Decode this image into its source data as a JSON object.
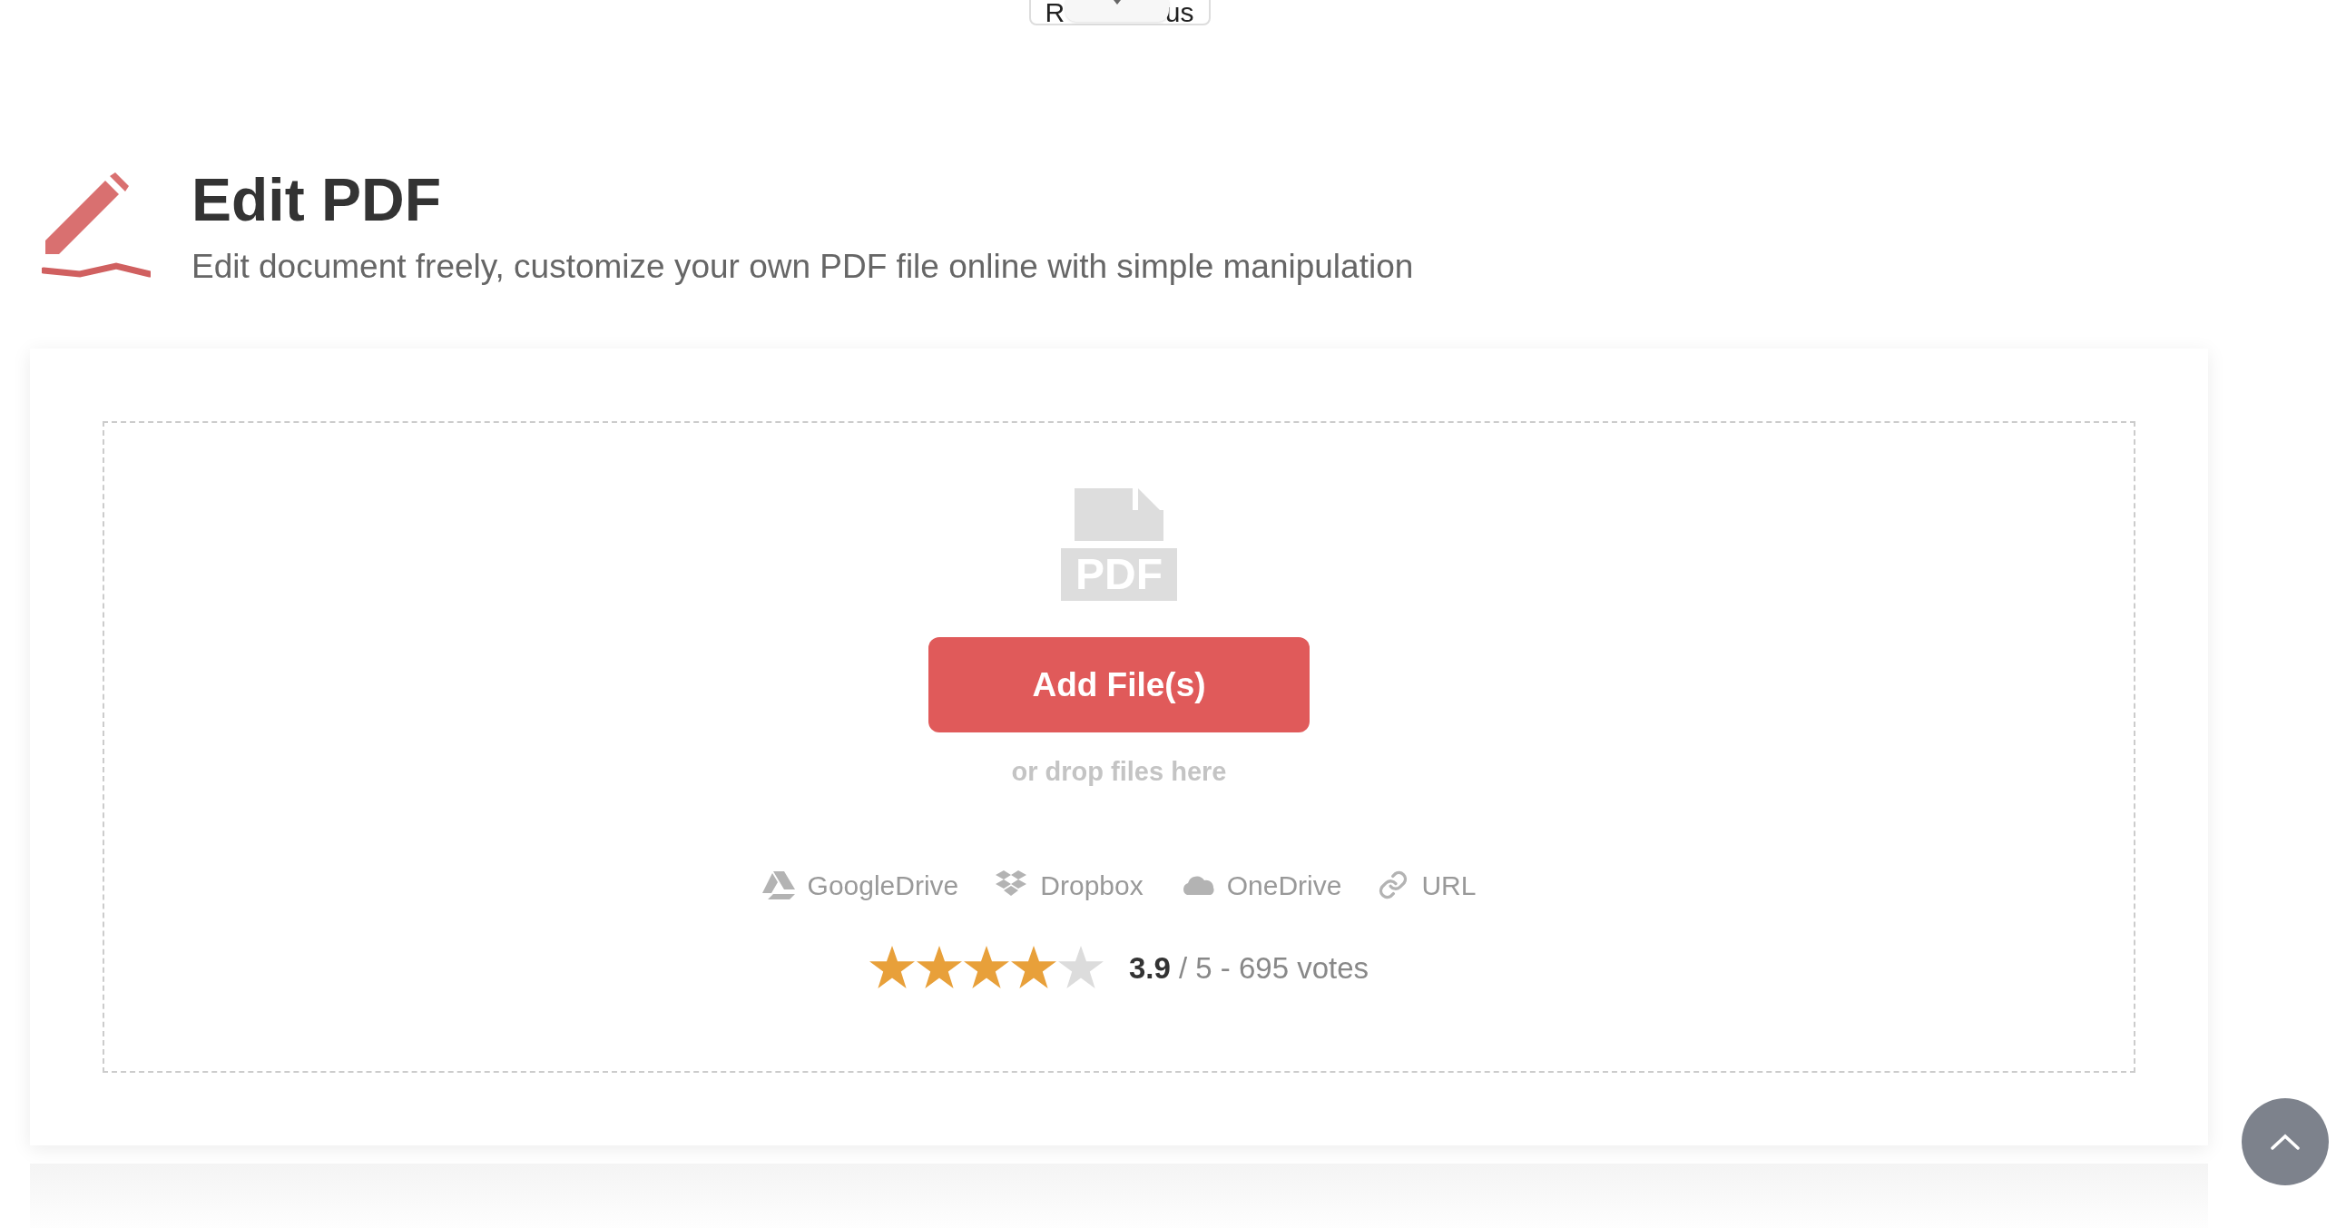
{
  "top_button": {
    "text_left": "R",
    "text_right": "us"
  },
  "header": {
    "title": "Edit PDF",
    "subtitle": "Edit document freely, customize your own PDF file online with simple manipulation"
  },
  "upload": {
    "file_icon_label": "PDF",
    "button": "Add File(s)",
    "hint": "or drop files here",
    "sources": [
      {
        "kind": "googledrive",
        "label": "GoogleDrive"
      },
      {
        "kind": "dropbox",
        "label": "Dropbox"
      },
      {
        "kind": "onedrive",
        "label": "OneDrive"
      },
      {
        "kind": "url",
        "label": "URL"
      }
    ]
  },
  "rating": {
    "stars": 4,
    "text": "**3.9** / 5 - 695 votes"
  }
}
